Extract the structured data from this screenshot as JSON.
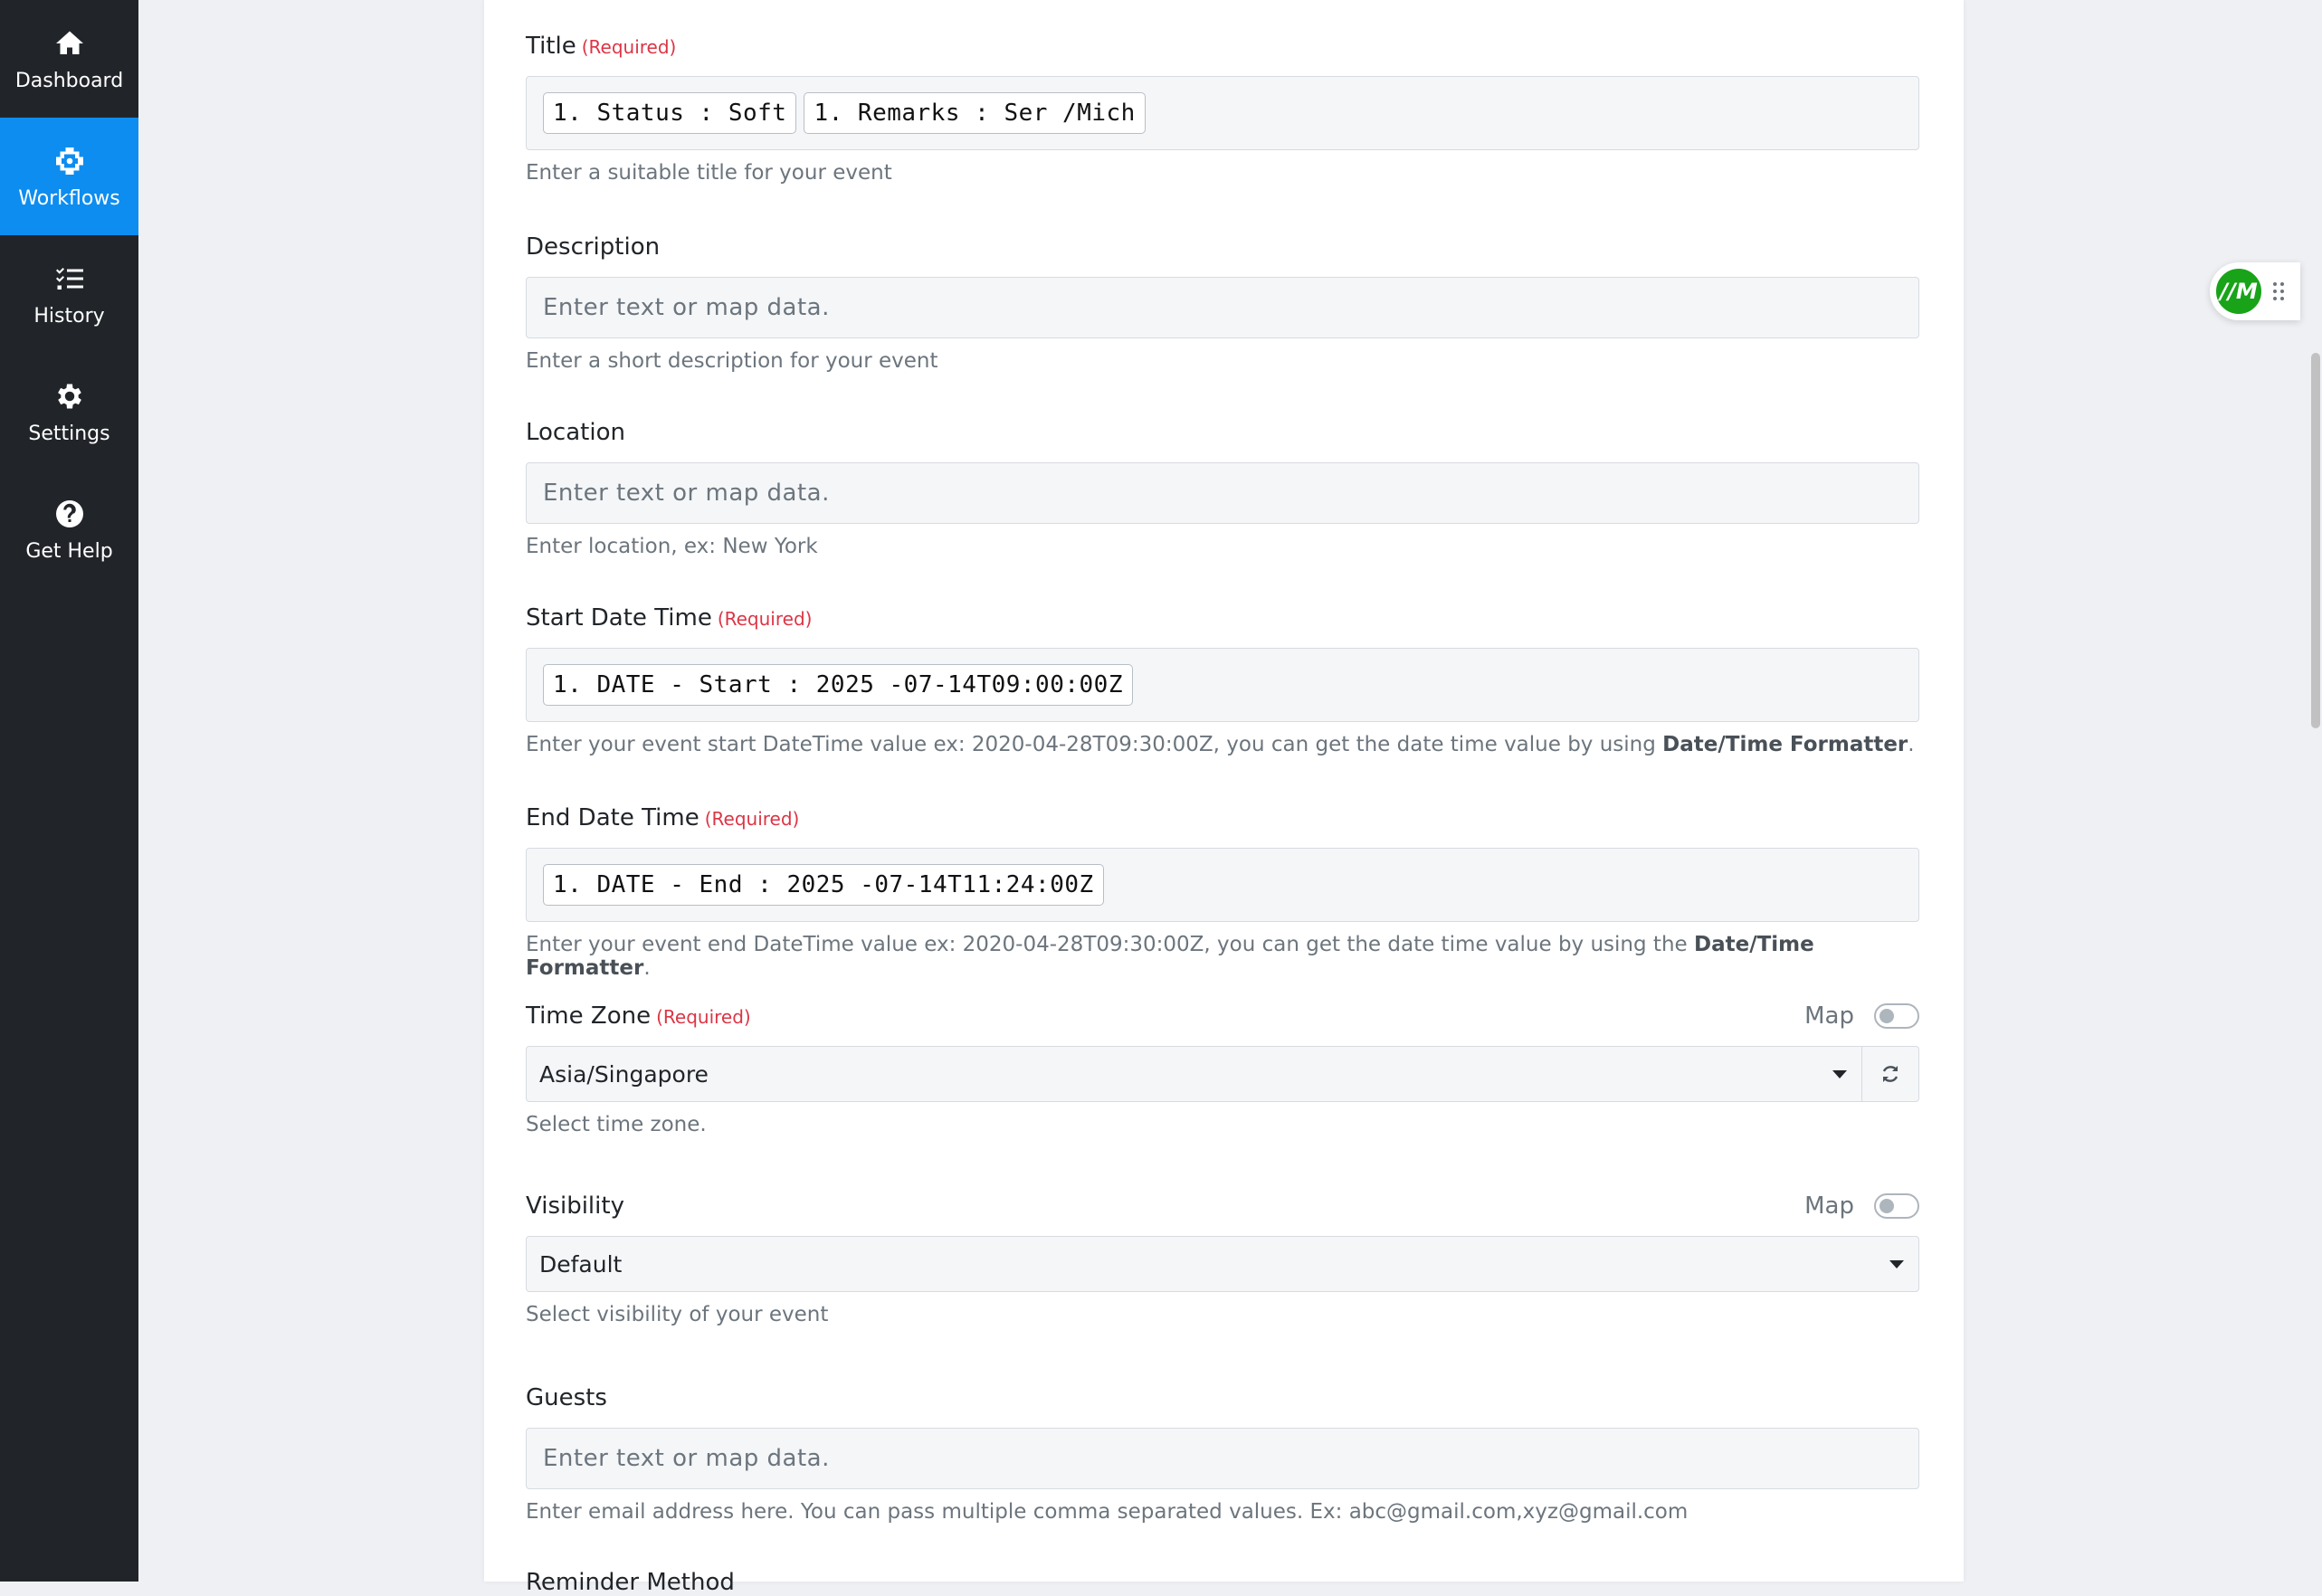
{
  "sidebar": {
    "items": [
      {
        "label": "Dashboard",
        "icon": "home-icon"
      },
      {
        "label": "Workflows",
        "icon": "workflow-icon",
        "active": true
      },
      {
        "label": "History",
        "icon": "list-check-icon"
      },
      {
        "label": "Settings",
        "icon": "gear-icon"
      },
      {
        "label": "Get Help",
        "icon": "question-circle-icon"
      }
    ]
  },
  "form": {
    "required_text": "(Required)",
    "title": {
      "label": "Title",
      "pills": [
        "1. Status : Soft",
        "1. Remarks : Ser /Mich"
      ],
      "help": "Enter a suitable title for your event"
    },
    "description": {
      "label": "Description",
      "placeholder": "Enter text or map data.",
      "help": "Enter a short description for your event"
    },
    "location": {
      "label": "Location",
      "placeholder": "Enter text or map data.",
      "help": "Enter location, ex: New York"
    },
    "start_date_time": {
      "label": "Start Date Time",
      "pill": "1. DATE - Start : 2025 -07-14T09:00:00Z",
      "help_prefix": "Enter your event start DateTime value ex: 2020-04-28T09:30:00Z, you can get the date time value by using ",
      "help_bold": "Date/Time Formatter",
      "help_suffix": "."
    },
    "end_date_time": {
      "label": "End Date Time",
      "pill": "1. DATE - End : 2025 -07-14T11:24:00Z",
      "help_prefix": "Enter your event end DateTime value ex: 2020-04-28T09:30:00Z, you can get the date time value by using the ",
      "help_bold": "Date/Time Formatter",
      "help_suffix": "."
    },
    "time_zone": {
      "label": "Time Zone",
      "map_label": "Map",
      "selected": "Asia/Singapore",
      "help": "Select time zone."
    },
    "visibility": {
      "label": "Visibility",
      "map_label": "Map",
      "selected": "Default",
      "help": "Select visibility of your event"
    },
    "guests": {
      "label": "Guests",
      "placeholder": "Enter text or map data.",
      "help": "Enter email address here. You can pass multiple comma separated values. Ex: abc@gmail.com,xyz@gmail.com"
    },
    "reminder_method": {
      "label": "Reminder Method"
    }
  },
  "widget": {
    "logo_text": "//M"
  },
  "colors": {
    "sidebar_bg": "#212529",
    "active": "#0d8df0",
    "required": "#dc3545",
    "logo_green": "#19a319"
  }
}
